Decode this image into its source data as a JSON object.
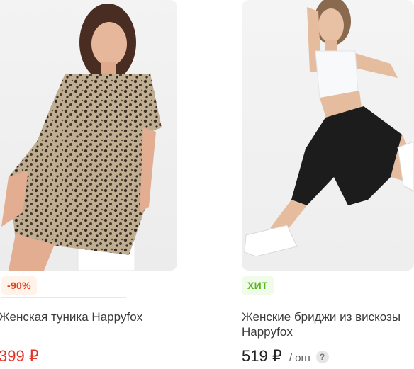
{
  "products": [
    {
      "badge": "-90%",
      "title": "Женская туника Happyfox",
      "price": "399 ₽"
    },
    {
      "badge": "ХИТ",
      "title": "Женские бриджи из вискозы Happyfox",
      "price": "519 ₽",
      "unit": "/ опт",
      "help": "?"
    }
  ],
  "colors": {
    "discount_badge_text": "#e0401e",
    "hit_badge_text": "#56b81c",
    "sale_price": "#e3342b"
  }
}
